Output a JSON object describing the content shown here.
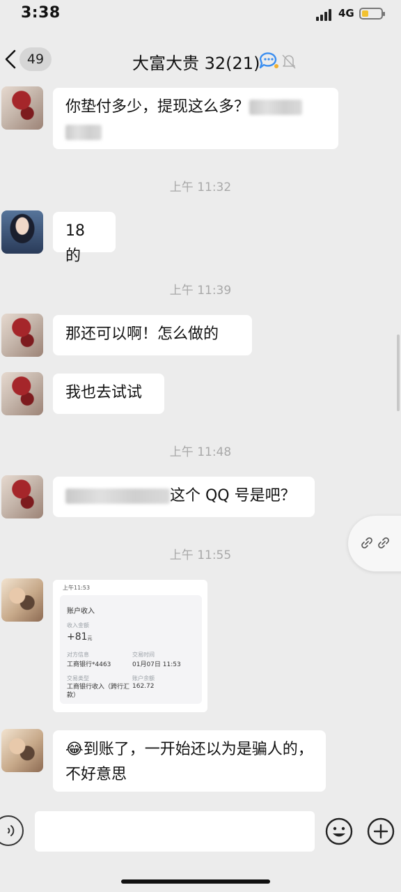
{
  "status_bar": {
    "time": "3:38",
    "network": "4G",
    "battery_level": 0.35,
    "battery_color": "#f2c230"
  },
  "nav": {
    "back_icon": "chevron-left-icon",
    "unread_count": "49",
    "title": "大富大贵 32(21)",
    "title_icons": [
      "chat-bubble-icon",
      "bell-muted-icon"
    ]
  },
  "messages": [
    {
      "sender_avatar": "red",
      "text": "你垫付多少，提现这么多？",
      "redacted": true
    },
    {
      "time": "上午 11:32"
    },
    {
      "sender_avatar": "blue",
      "text": "18 的"
    },
    {
      "time": "上午 11:39"
    },
    {
      "sender_avatar": "red",
      "text": "那还可以啊！怎么做的"
    },
    {
      "sender_avatar": "red",
      "text": "我也去试试"
    },
    {
      "time": "上午 11:48"
    },
    {
      "sender_avatar": "red",
      "text": "这个 QQ 号是吧？",
      "redacted_prefix": true
    },
    {
      "time": "上午 11:55"
    },
    {
      "sender_avatar": "tan",
      "receipt": {
        "header_time": "上午11:53",
        "title": "账户收入",
        "amount_label": "收入金额",
        "amount": "+81",
        "amount_unit": "元",
        "account_label": "对方信息",
        "account_value": "工商银行*4463",
        "trade_time_label": "交易时间",
        "trade_time_value": "01月07日 11:53",
        "trade_type_label": "交易类型",
        "trade_type_value": "工商银行收入（跨行汇款）",
        "balance_label": "账户余额",
        "balance_value": "162.72"
      }
    },
    {
      "sender_avatar": "tan",
      "emoji": "😂",
      "text": "到账了，一开始还以为是骗人的，不好意思"
    }
  ],
  "float_button_icons": [
    "link-icon",
    "link-icon"
  ],
  "input_bar": {
    "voice_icon": "voice-icon",
    "placeholder": "",
    "emoji_icon": "smile-icon",
    "plus_icon": "plus-icon"
  }
}
